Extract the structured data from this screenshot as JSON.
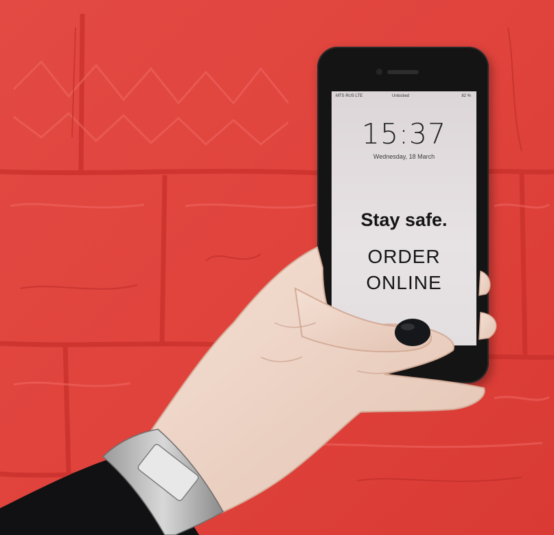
{
  "scene": {
    "wall_color": "#e2443d",
    "phone_color": "#141414",
    "nail_color": "#15171a",
    "skin_color": "#efd6c8"
  },
  "lockscreen": {
    "carrier": "MTS RUS LTE",
    "status_center": "Unlocked",
    "battery": "82 %",
    "time": "15:37",
    "date": "Wednesday, 18 March",
    "headline": "Stay safe.",
    "cta_line1": "ORDER",
    "cta_line2": "ONLINE"
  }
}
